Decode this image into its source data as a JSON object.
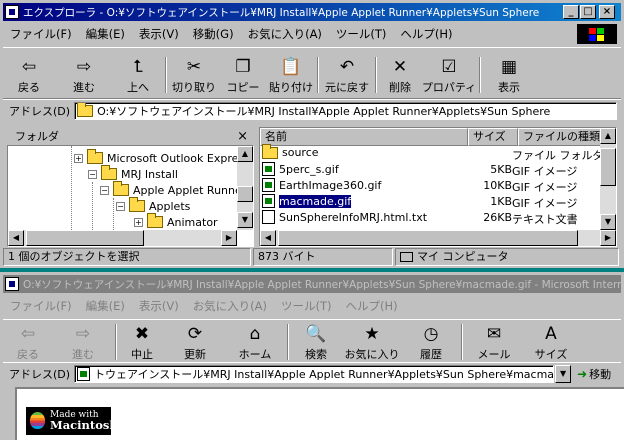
{
  "explorer": {
    "title": "エクスプローラ - O:¥ソフトウェアインストール¥MRJ Install¥Apple Applet Runner¥Applets¥Sun Sphere",
    "menu": [
      "ファイル(F)",
      "編集(E)",
      "表示(V)",
      "移動(G)",
      "お気に入り(A)",
      "ツール(T)",
      "ヘルプ(H)"
    ],
    "toolbar": [
      {
        "label": "戻る",
        "icon": "back-arrow-icon",
        "glyph": "⇦"
      },
      {
        "label": "進む",
        "icon": "forward-arrow-icon",
        "glyph": "⇨"
      },
      {
        "label": "上へ",
        "icon": "up-folder-icon",
        "glyph": "⮤"
      },
      {
        "label": "切り取り",
        "icon": "scissors-icon",
        "glyph": "✂"
      },
      {
        "label": "コピー",
        "icon": "copy-icon",
        "glyph": "❐"
      },
      {
        "label": "貼り付け",
        "icon": "paste-icon",
        "glyph": "📋"
      },
      {
        "label": "元に戻す",
        "icon": "undo-icon",
        "glyph": "↶"
      },
      {
        "label": "削除",
        "icon": "delete-icon",
        "glyph": "✕"
      },
      {
        "label": "プロパティ",
        "icon": "properties-icon",
        "glyph": "☑"
      },
      {
        "label": "表示",
        "icon": "views-icon",
        "glyph": "▦"
      }
    ],
    "address_label": "アドレス(D)",
    "address": "O:¥ソフトウェアインストール¥MRJ Install¥Apple Applet Runner¥Applets¥Sun Sphere",
    "tree_title": "フォルダ",
    "tree_close": "×",
    "tree": [
      {
        "label": "Microsoft Outlook Expres",
        "pm": "+"
      },
      {
        "label": "MRJ Install",
        "pm": "−"
      },
      {
        "label": "Apple Applet Runner",
        "pm": "−"
      },
      {
        "label": "Applets",
        "pm": "−"
      },
      {
        "label": "Animator",
        "pm": "+"
      }
    ],
    "columns": {
      "name": "名前",
      "size": "サイズ",
      "type": "ファイルの種類"
    },
    "files": [
      {
        "name": "source",
        "size": "",
        "type": "ファイル フォルダ",
        "kind": "folder"
      },
      {
        "name": "5perc_s.gif",
        "size": "5KB",
        "type": "GIF イメージ",
        "kind": "gif"
      },
      {
        "name": "EarthImage360.gif",
        "size": "10KB",
        "type": "GIF イメージ",
        "kind": "gif"
      },
      {
        "name": "macmade.gif",
        "size": "1KB",
        "type": "GIF イメージ",
        "kind": "gif",
        "selected": true
      },
      {
        "name": "SunSphereInfoMRJ.html.txt",
        "size": "26KB",
        "type": "テキスト文書",
        "kind": "txt"
      }
    ],
    "status": {
      "selection": "1 個のオブジェクトを選択",
      "size": "873 バイト",
      "location": "マイ コンピュータ"
    }
  },
  "browser": {
    "title": "O:¥ソフトウェアインストール¥MRJ Install¥Apple Applet Runner¥Applets¥Sun Sphere¥macmade.gif - Microsoft Internet...",
    "menu": [
      "ファイル(F)",
      "編集(E)",
      "表示(V)",
      "お気に入り(A)",
      "ツール(T)",
      "ヘルプ(H)"
    ],
    "toolbar": [
      {
        "label": "戻る",
        "icon": "back-arrow-icon",
        "glyph": "⇦",
        "disabled": true
      },
      {
        "label": "進む",
        "icon": "forward-arrow-icon",
        "glyph": "⇨",
        "disabled": true
      },
      {
        "label": "中止",
        "icon": "stop-icon",
        "glyph": "✖"
      },
      {
        "label": "更新",
        "icon": "refresh-icon",
        "glyph": "⟳"
      },
      {
        "label": "ホーム",
        "icon": "home-icon",
        "glyph": "⌂"
      },
      {
        "label": "検索",
        "icon": "search-icon",
        "glyph": "🔍"
      },
      {
        "label": "お気に入り",
        "icon": "favorites-icon",
        "glyph": "★"
      },
      {
        "label": "履歴",
        "icon": "history-icon",
        "glyph": "◷"
      },
      {
        "label": "メール",
        "icon": "mail-icon",
        "glyph": "✉"
      },
      {
        "label": "サイズ",
        "icon": "font-size-icon",
        "glyph": "A"
      }
    ],
    "address_label": "アドレス(D)",
    "address": "トウェアインストール¥MRJ Install¥Apple Applet Runner¥Applets¥Sun Sphere¥macmade.gif",
    "go_label": "移動",
    "image": {
      "line1": "Made with",
      "line2": "Macintosh"
    }
  }
}
